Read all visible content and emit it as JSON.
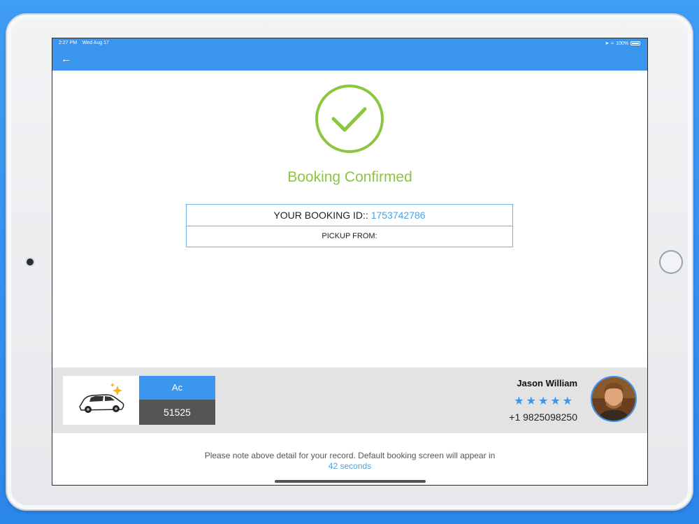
{
  "status_bar": {
    "time": "2:27 PM",
    "date": "Wed Aug 17",
    "battery": "100%"
  },
  "header": {
    "back_icon": "arrow-left-icon",
    "color": "#3a95ef"
  },
  "confirmation": {
    "icon": "check-circle-icon",
    "title": "Booking Confirmed",
    "title_color": "#8cc63f",
    "booking_id_label": "YOUR BOOKING ID::",
    "booking_id": "1753742786",
    "pickup_label": "PICKUP FROM:"
  },
  "driver": {
    "vehicle_type": "Ac",
    "vehicle_number": "51525",
    "name": "Jason William",
    "rating": 5,
    "phone": "+1 9825098250",
    "car_icon": "taxi-car-icon",
    "avatar_icon": "driver-avatar"
  },
  "footer": {
    "note": "Please note above detail for your record. Default booking screen will appear in",
    "countdown": "42 seconds"
  },
  "colors": {
    "accent": "#3a95ef",
    "success": "#8cc63f",
    "link": "#4aa3e0",
    "panel": "#e3e3e3"
  }
}
